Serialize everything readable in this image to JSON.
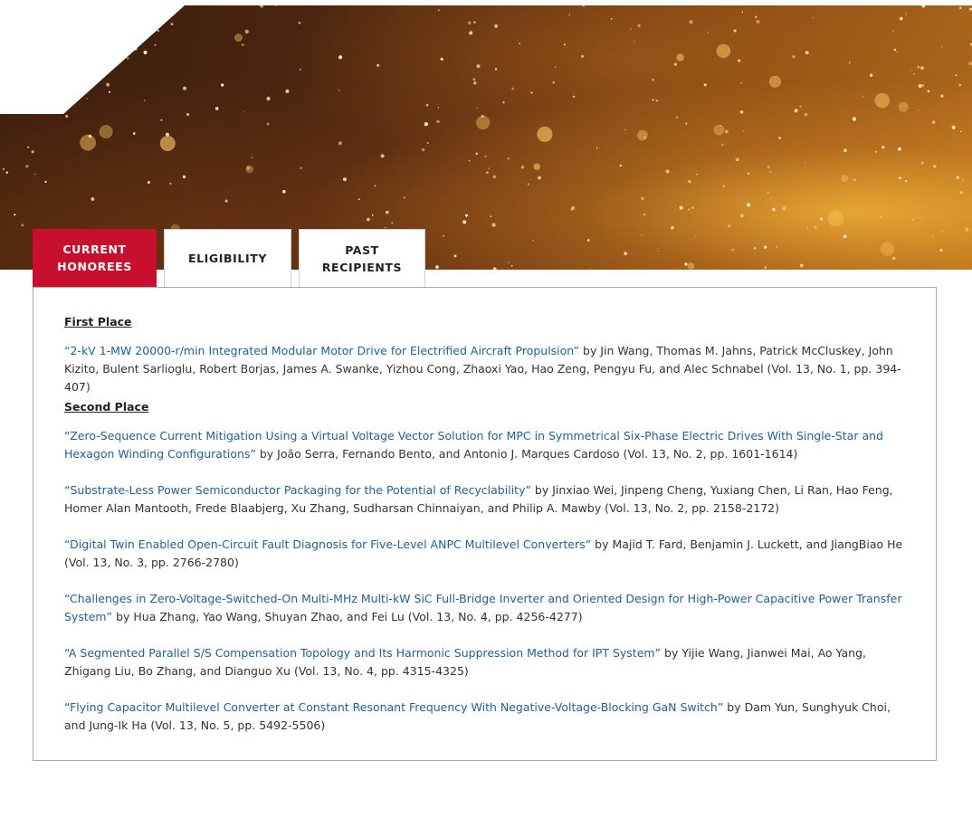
{
  "tabs": [
    {
      "label": "CURRENT HONOREES",
      "line1": "CURRENT",
      "line2": "HONOREES",
      "active": true
    },
    {
      "label": "ELIGIBILITY",
      "active": false
    },
    {
      "label": "PAST RECIPIENTS",
      "line1": "PAST",
      "line2": "RECIPIENTS",
      "active": false
    }
  ],
  "colors": {
    "active_tab": "#c8102e",
    "link": "#1f5f9f",
    "body_text": "#333333",
    "panel_border": "#a8a8a8"
  },
  "sections": [
    {
      "heading": "First Place",
      "entries": [
        {
          "title": "“2-kV 1-MW 20000-r/min Integrated Modular Motor Drive for Electrified Aircraft Propulsion”",
          "details": " by Jin Wang, Thomas M. Jahns, Patrick McCluskey, John Kizito, Bulent Sarlioglu, Robert Borjas, James A. Swanke, Yizhou Cong, Zhaoxi Yao, Hao Zeng, Pengyu Fu, and Alec Schnabel (Vol. 13, No. 1, pp. 394-407)"
        }
      ]
    },
    {
      "heading": "Second Place",
      "entries": [
        {
          "title": "“Zero-Sequence Current Mitigation Using a Virtual Voltage Vector Solution for MPC in Symmetrical Six-Phase Electric Drives With Single-Star and Hexagon Winding Configurations”",
          "details": "  by João Serra, Fernando Bento, and Antonio J. Marques Cardoso (Vol. 13, No. 2, pp. 1601-1614)"
        },
        {
          "title": "“Substrate-Less Power Semiconductor Packaging for the Potential of Recyclability”",
          "details": " by Jinxiao Wei, Jinpeng Cheng, Yuxiang Chen, Li Ran, Hao Feng, Homer Alan Mantooth, Frede Blaabjerg, Xu Zhang, Sudharsan Chinnaiyan, and Philip A. Mawby (Vol. 13, No. 2, pp. 2158-2172)"
        },
        {
          "title": "“Digital Twin Enabled Open-Circuit Fault Diagnosis for Five-Level ANPC Multilevel Converters”",
          "details": " by Majid T. Fard, Benjamin J. Luckett, and JiangBiao He (Vol. 13, No. 3, pp. 2766-2780)"
        },
        {
          "title": "“Challenges in Zero-Voltage-Switched-On Multi-MHz Multi-kW SiC Full-Bridge Inverter and Oriented Design for High-Power Capacitive Power Transfer System”",
          "details": " by Hua Zhang, Yao Wang, Shuyan Zhao, and Fei Lu (Vol. 13, No. 4, pp. 4256-4277)"
        },
        {
          "title": "“A Segmented Parallel S/S Compensation Topology and Its Harmonic Suppression Method for IPT System”",
          "details": " by Yijie Wang, Jianwei Mai, Ao Yang, Zhigang Liu, Bo Zhang, and Dianguo Xu (Vol. 13, No. 4, pp. 4315-4325)"
        },
        {
          "title": "“Flying Capacitor Multilevel Converter at Constant Resonant Frequency With Negative-Voltage-Blocking GaN Switch”",
          "details": " by Dam Yun, Sunghyuk Choi, and Jung-Ik Ha (Vol. 13, No. 5, pp. 5492-5506)"
        }
      ]
    }
  ]
}
